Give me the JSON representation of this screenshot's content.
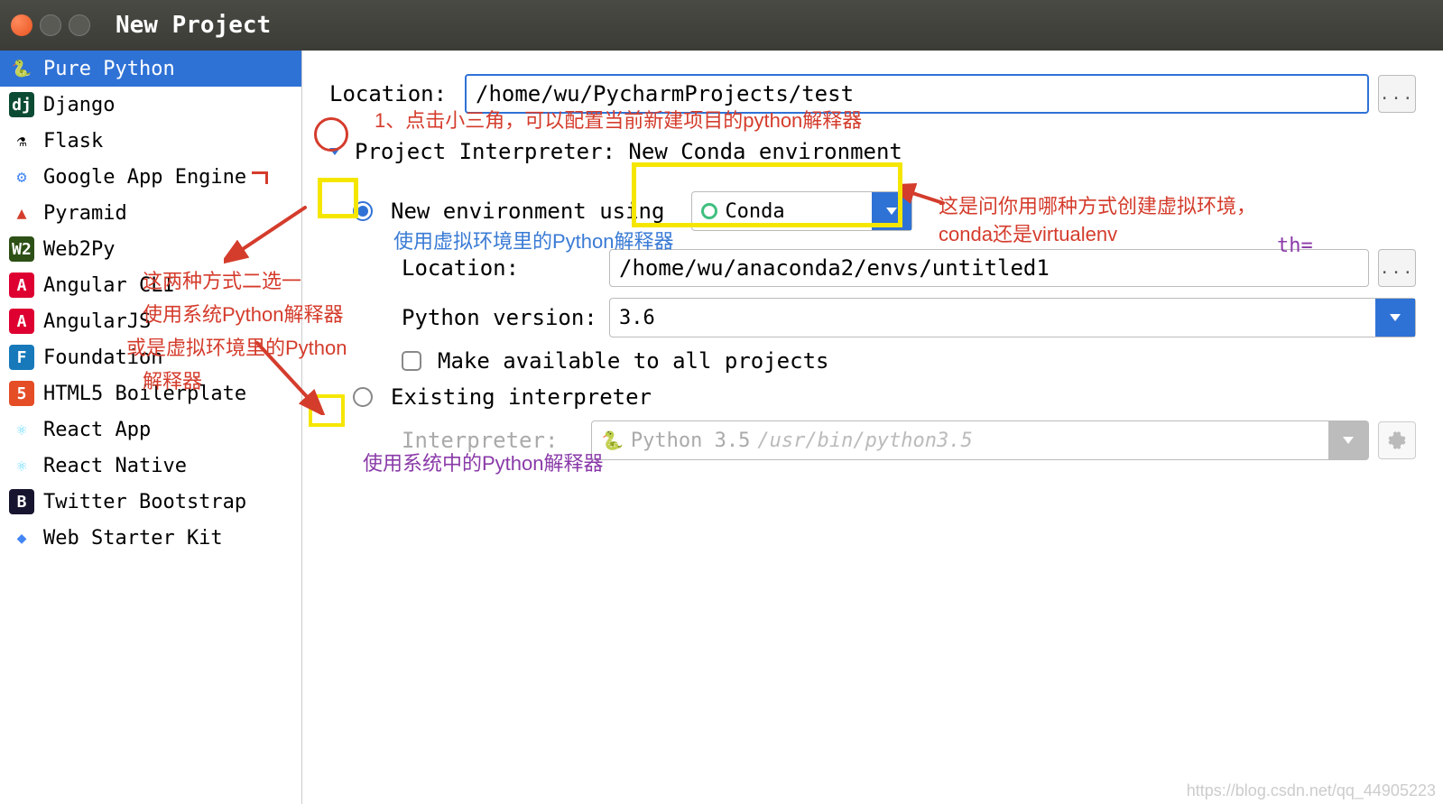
{
  "window": {
    "title": "New Project"
  },
  "sidebar": {
    "items": [
      {
        "label": "Pure Python",
        "icon": "🐍",
        "iconBg": "",
        "iconColor": "#f5c542"
      },
      {
        "label": "Django",
        "icon": "dj",
        "iconBg": "#0c4b33",
        "iconColor": "#fff"
      },
      {
        "label": "Flask",
        "icon": "⚗",
        "iconBg": "",
        "iconColor": "#000"
      },
      {
        "label": "Google App Engine",
        "icon": "⚙",
        "iconBg": "",
        "iconColor": "#4285f4"
      },
      {
        "label": "Pyramid",
        "icon": "▲",
        "iconBg": "",
        "iconColor": "#d43c2c"
      },
      {
        "label": "Web2Py",
        "icon": "W2",
        "iconBg": "#2d5016",
        "iconColor": "#fff"
      },
      {
        "label": "Angular CLI",
        "icon": "A",
        "iconBg": "#dd0031",
        "iconColor": "#fff"
      },
      {
        "label": "AngularJS",
        "icon": "A",
        "iconBg": "#dd0031",
        "iconColor": "#fff"
      },
      {
        "label": "Foundation",
        "icon": "F",
        "iconBg": "#1779ba",
        "iconColor": "#fff"
      },
      {
        "label": "HTML5 Boilerplate",
        "icon": "5",
        "iconBg": "#e44d26",
        "iconColor": "#fff"
      },
      {
        "label": "React App",
        "icon": "⚛",
        "iconBg": "",
        "iconColor": "#61dafb"
      },
      {
        "label": "React Native",
        "icon": "⚛",
        "iconBg": "",
        "iconColor": "#61dafb"
      },
      {
        "label": "Twitter Bootstrap",
        "icon": "B",
        "iconBg": "#17142f",
        "iconColor": "#fff"
      },
      {
        "label": "Web Starter Kit",
        "icon": "◆",
        "iconBg": "",
        "iconColor": "#4285f4"
      }
    ]
  },
  "form": {
    "location_label": "Location:",
    "location_value": "/home/wu/PycharmProjects/test",
    "interpreter_header": "Project Interpreter: New Conda environment",
    "new_env_label": "New environment using",
    "env_tool": "Conda",
    "env_location_label": "Location:",
    "env_location_value": "/home/wu/anaconda2/envs/untitled1",
    "python_version_label": "Python version:",
    "python_version_value": "3.6",
    "make_available_label": "Make available to all projects",
    "existing_label": "Existing interpreter",
    "existing_interpreter_label": "Interpreter:",
    "existing_interpreter_value": "Python 3.5",
    "existing_interpreter_path": "/usr/bin/python3.5"
  },
  "annotations": {
    "a1": "1、点击小三角，可以配置当前新建项目的python解释器",
    "a2": "使用虚拟环境里的Python解释器",
    "a3": "这是问你用哪种方式创建虚拟环境，conda还是virtualenv",
    "a4_1": "这两种方式二选一",
    "a4_2": "使用系统Python解释器",
    "a4_3": "或是虚拟环境里的Python",
    "a4_4": "解释器",
    "a5": "使用系统中的Python解释器",
    "side": "th=",
    "watermark": "https://blog.csdn.net/qq_44905223"
  }
}
